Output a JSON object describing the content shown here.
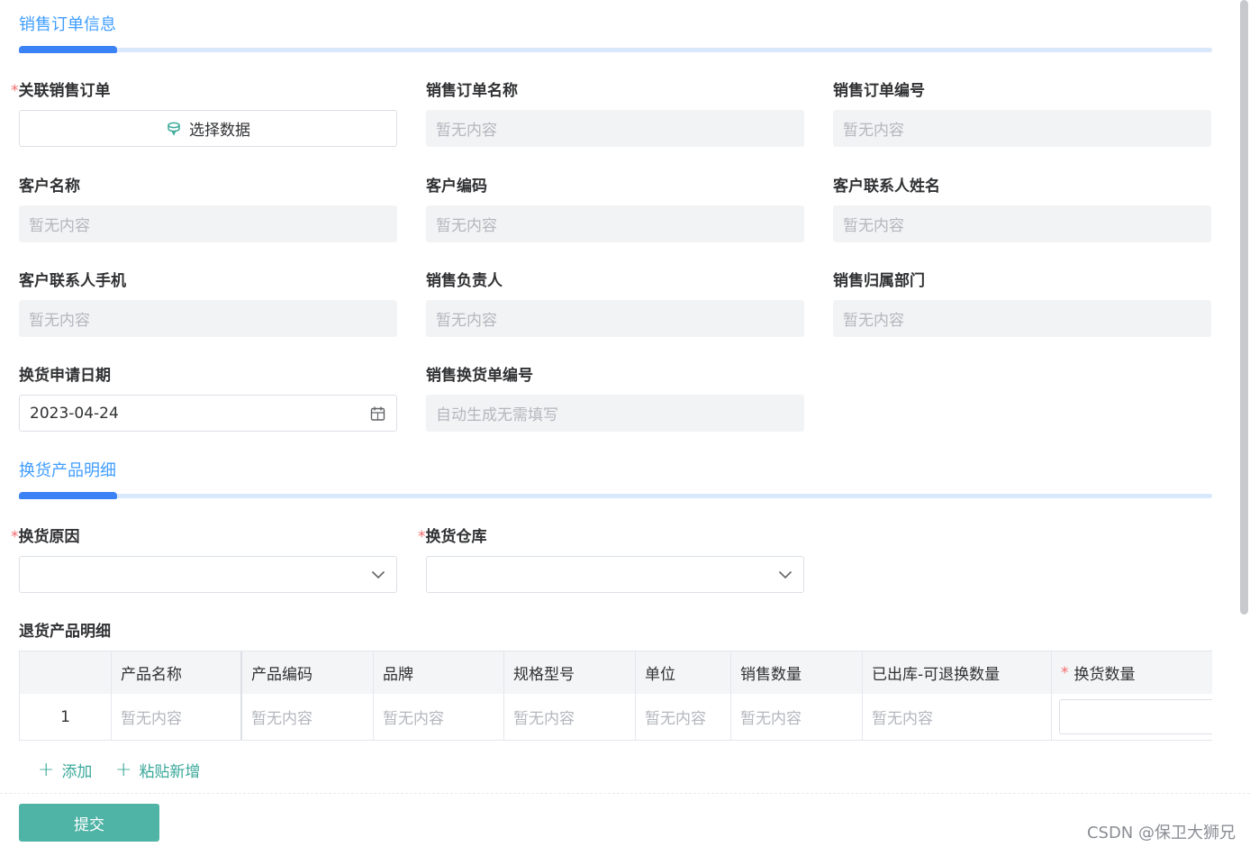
{
  "sections": {
    "order_info": "销售订单信息",
    "product_detail": "换货产品明细"
  },
  "placeholder_empty": "暂无内容",
  "form": {
    "related_order": {
      "label": "关联销售订单",
      "required_mark": "*",
      "button": "选择数据",
      "icon": "database-icon"
    },
    "order_name": {
      "label": "销售订单名称",
      "value": "暂无内容"
    },
    "order_no": {
      "label": "销售订单编号",
      "value": "暂无内容"
    },
    "customer_name": {
      "label": "客户名称",
      "value": "暂无内容"
    },
    "customer_code": {
      "label": "客户编码",
      "value": "暂无内容"
    },
    "contact_name": {
      "label": "客户联系人姓名",
      "value": "暂无内容"
    },
    "contact_phone": {
      "label": "客户联系人手机",
      "value": "暂无内容"
    },
    "sales_owner": {
      "label": "销售负责人",
      "value": "暂无内容"
    },
    "sales_dept": {
      "label": "销售归属部门",
      "value": "暂无内容"
    },
    "exchange_date": {
      "label": "换货申请日期",
      "value": "2023-04-24",
      "icon": "calendar-icon"
    },
    "exchange_no": {
      "label": "销售换货单编号",
      "value": "自动生成无需填写"
    },
    "exchange_reason": {
      "label": "换货原因",
      "required_mark": "*",
      "value": ""
    },
    "exchange_warehouse": {
      "label": "换货仓库",
      "required_mark": "*",
      "value": ""
    }
  },
  "return_table": {
    "title": "退货产品明细",
    "columns": [
      "",
      "产品名称",
      "产品编码",
      "品牌",
      "规格型号",
      "单位",
      "销售数量",
      "已出库-可退换数量",
      "换货数量"
    ],
    "required_column_mark": "*",
    "rows": [
      [
        "1",
        "暂无内容",
        "暂无内容",
        "暂无内容",
        "暂无内容",
        "暂无内容",
        "暂无内容",
        "暂无内容",
        ""
      ]
    ],
    "add_label": "添加",
    "paste_add_label": "粘贴新增"
  },
  "submit_label": "提交",
  "watermark": "CSDN @保卫大狮兄",
  "colors": {
    "accent_blue": "#409eff",
    "accent_bar": "#3b82f6",
    "teal": "#4fb3a6",
    "required": "#f56c6c",
    "disabled_bg": "#f2f3f5"
  }
}
